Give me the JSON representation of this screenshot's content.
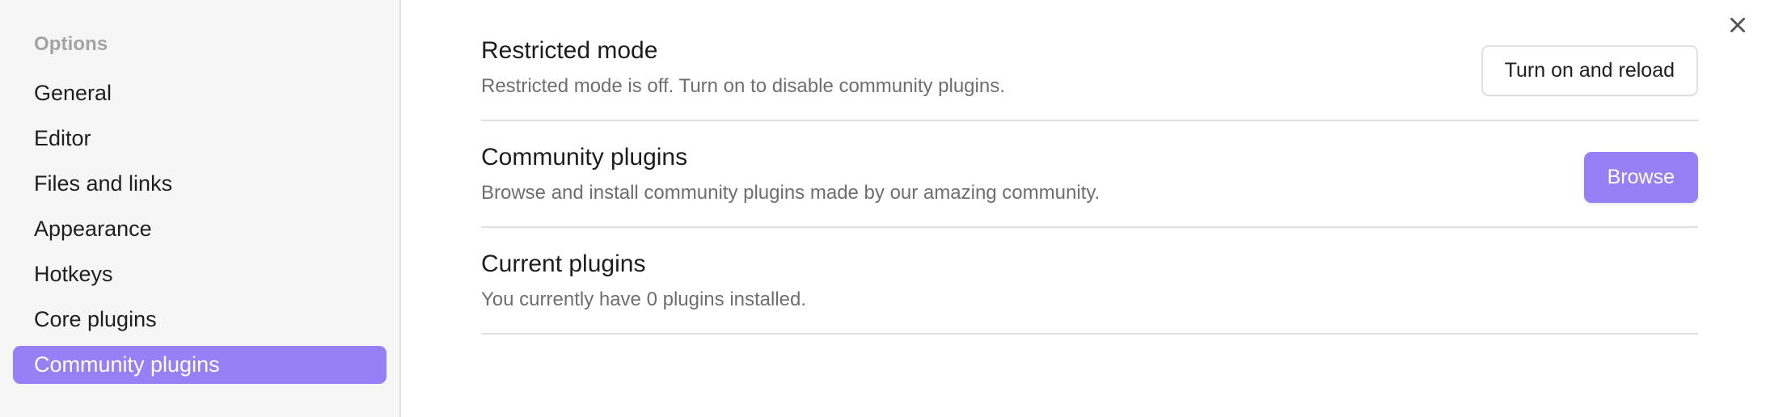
{
  "sidebar": {
    "header": "Options",
    "items": [
      {
        "label": "General",
        "selected": false
      },
      {
        "label": "Editor",
        "selected": false
      },
      {
        "label": "Files and links",
        "selected": false
      },
      {
        "label": "Appearance",
        "selected": false
      },
      {
        "label": "Hotkeys",
        "selected": false
      },
      {
        "label": "Core plugins",
        "selected": false
      },
      {
        "label": "Community plugins",
        "selected": true
      }
    ]
  },
  "main": {
    "close_icon": "close-icon",
    "settings": [
      {
        "title": "Restricted mode",
        "description": "Restricted mode is off. Turn on to disable community plugins.",
        "button_label": "Turn on and reload",
        "button_style": "default"
      },
      {
        "title": "Community plugins",
        "description": "Browse and install community plugins made by our amazing community.",
        "button_label": "Browse",
        "button_style": "cta"
      },
      {
        "title": "Current plugins",
        "description": "You currently have 0 plugins installed.",
        "button_label": "",
        "button_style": "none"
      }
    ]
  },
  "colors": {
    "accent": "#9580f5",
    "sidebar_bg": "#f6f6f6",
    "divider": "#e0e0e0",
    "muted_text": "#6e6e6e",
    "header_text": "#a3a3a3"
  }
}
